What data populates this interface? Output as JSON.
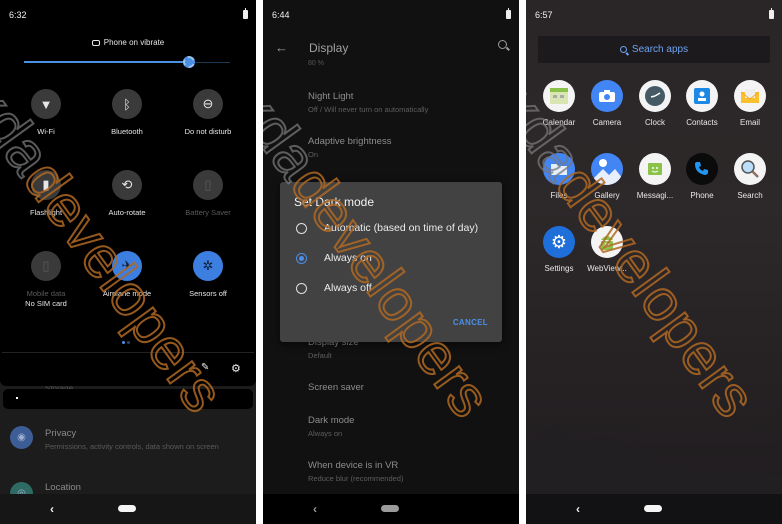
{
  "watermark": {
    "part1": "xda",
    "part2": "developers"
  },
  "panel1": {
    "status": {
      "time": "6:32"
    },
    "ringer": {
      "icon": "vibrate-icon",
      "label": "Phone on vibrate"
    },
    "brightness": {
      "value_percent": 80,
      "accent": "#4a90e2"
    },
    "tiles": [
      {
        "label": "Wi-Fi",
        "icon": "wifi-icon",
        "active": false,
        "dim": false
      },
      {
        "label": "Bluetooth",
        "icon": "bluetooth-icon",
        "active": false,
        "dim": false
      },
      {
        "label": "Do not disturb",
        "icon": "do-not-disturb-icon",
        "active": false,
        "dim": false
      },
      {
        "label": "Flashlight",
        "icon": "flashlight-icon",
        "active": false,
        "dim": false
      },
      {
        "label": "Auto-rotate",
        "icon": "auto-rotate-icon",
        "active": false,
        "dim": false
      },
      {
        "label": "Battery Saver",
        "icon": "battery-saver-icon",
        "active": false,
        "dim": true
      },
      {
        "label": "Mobile data",
        "sublabel": "No SIM card",
        "icon": "mobile-data-icon",
        "active": false,
        "dim": true
      },
      {
        "label": "Airplane mode",
        "icon": "airplane-icon",
        "active": true,
        "dim": false
      },
      {
        "label": "Sensors off",
        "icon": "sensors-off-icon",
        "active": true,
        "dim": false
      }
    ],
    "page_dots": {
      "count": 2,
      "active_index": 0
    },
    "peek_label": "Storage",
    "settings_items": [
      {
        "title": "Privacy",
        "subtitle": "Permissions, activity controls, data shown on screen",
        "icon": "privacy-icon",
        "icon_color": "#3c5d96"
      },
      {
        "title": "Location",
        "subtitle": "",
        "icon": "location-icon",
        "icon_color": "#2e6b63"
      }
    ],
    "nav": {
      "back": "‹"
    }
  },
  "panel2": {
    "status": {
      "time": "6:44"
    },
    "appbar": {
      "title": "Display"
    },
    "top_peek": "80 %",
    "prefs": [
      {
        "title": "Night Light",
        "subtitle": "Off / Will never turn on automatically"
      },
      {
        "title": "Adaptive brightness",
        "subtitle": "On"
      },
      {
        "title": "Display size",
        "subtitle": "Default"
      },
      {
        "title": "Screen saver",
        "subtitle": ""
      },
      {
        "title": "Dark mode",
        "subtitle": "Always on"
      },
      {
        "title": "When device is in VR",
        "subtitle": "Reduce blur (recommended)"
      }
    ],
    "dialog": {
      "title": "Set Dark mode",
      "options": [
        {
          "label": "Automatic (based on time of day)",
          "selected": false
        },
        {
          "label": "Always on",
          "selected": true
        },
        {
          "label": "Always off",
          "selected": false
        }
      ],
      "cancel_label": "CANCEL",
      "accent": "#4a8fe8"
    },
    "nav": {
      "back": "‹"
    }
  },
  "panel3": {
    "status": {
      "time": "6:57"
    },
    "search": {
      "placeholder": "Search apps"
    },
    "apps": [
      {
        "name": "Calendar",
        "icon": "calendar-icon"
      },
      {
        "name": "Camera",
        "icon": "camera-icon"
      },
      {
        "name": "Clock",
        "icon": "clock-icon"
      },
      {
        "name": "Contacts",
        "icon": "contacts-icon"
      },
      {
        "name": "Email",
        "icon": "email-icon"
      },
      {
        "name": "Files",
        "icon": "files-icon"
      },
      {
        "name": "Gallery",
        "icon": "gallery-icon"
      },
      {
        "name": "Messagi...",
        "icon": "messaging-icon"
      },
      {
        "name": "Phone",
        "icon": "phone-icon"
      },
      {
        "name": "Search",
        "icon": "search-app-icon"
      },
      {
        "name": "Settings",
        "icon": "settings-icon"
      },
      {
        "name": "WebView...",
        "icon": "webview-icon"
      }
    ],
    "nav": {
      "back": "‹"
    }
  }
}
